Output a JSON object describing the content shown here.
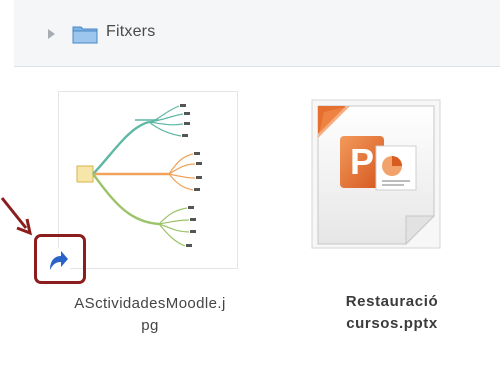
{
  "folder": {
    "label": "Fitxers",
    "icon": "folder-icon"
  },
  "files": [
    {
      "name": "ASctividadesMoodle.j\npg",
      "thumbnail": "mindmap-thumbnail",
      "overlay_icon": "shortcut-arrow-icon"
    },
    {
      "name": "Restauració\ncursos.pptx",
      "thumbnail": "powerpoint-icon"
    }
  ],
  "colors": {
    "highlight": "#8b1d1d",
    "ppt_orange": "#e0692f",
    "shortcut_blue": "#2a62c8"
  }
}
